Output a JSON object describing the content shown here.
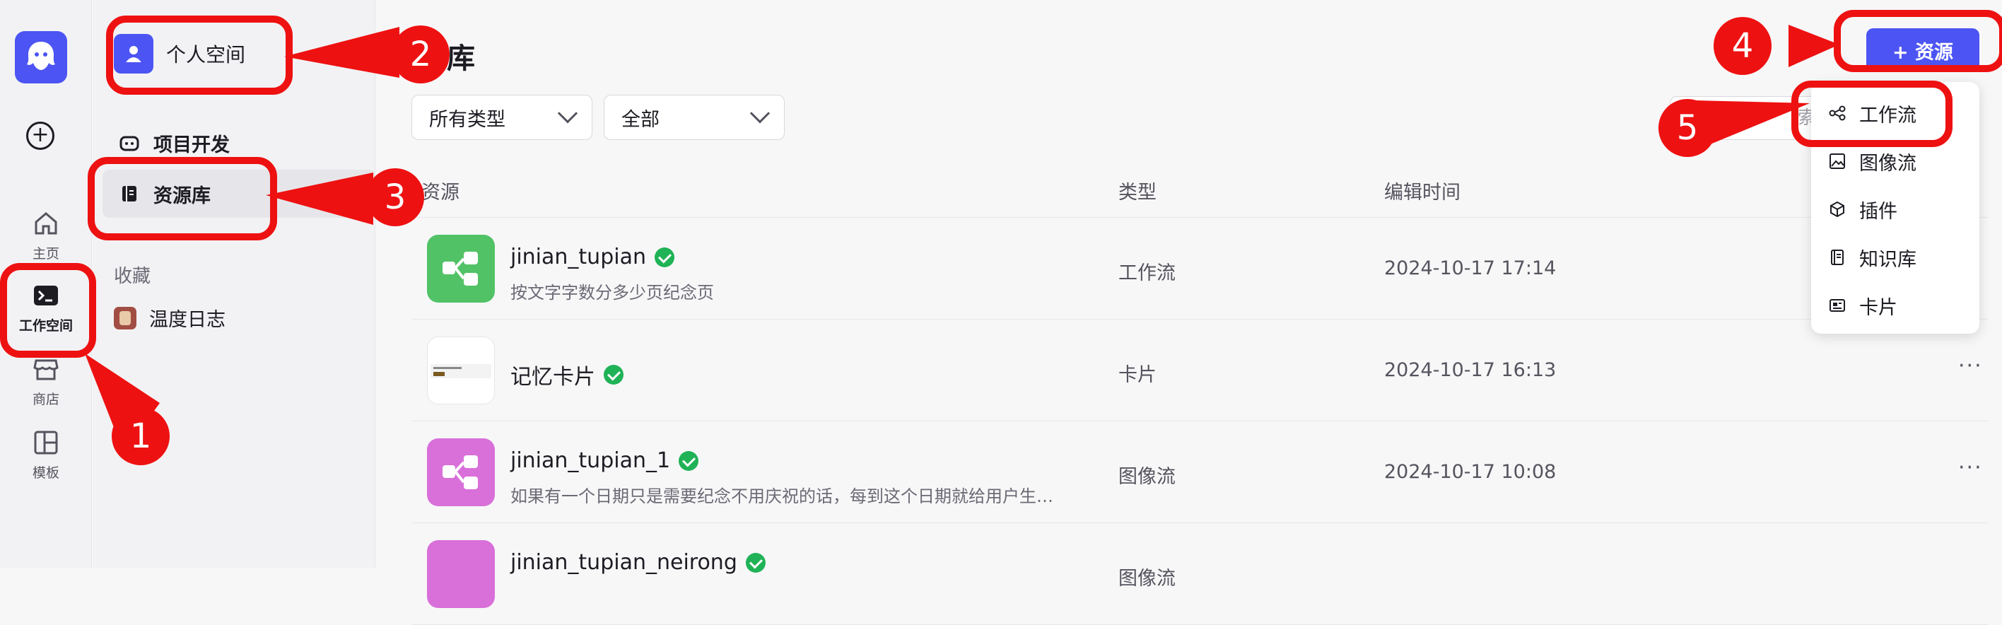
{
  "rail": {
    "items": [
      {
        "label": "主页"
      },
      {
        "label": "工作空间"
      },
      {
        "label": "商店"
      },
      {
        "label": "模板"
      }
    ]
  },
  "nav": {
    "space_label": "个人空间",
    "items": [
      {
        "label": "项目开发"
      },
      {
        "label": "资源库"
      }
    ],
    "favorites_title": "收藏",
    "favorites": [
      {
        "label": "温度日志"
      }
    ]
  },
  "main": {
    "title": "源库",
    "filter_type": "所有类型",
    "filter_scope": "全部",
    "add_button": "+ 资源",
    "search_placeholder": "索资源",
    "columns": [
      "资源",
      "类型",
      "编辑时间"
    ],
    "rows": [
      {
        "name": "jinian_tupian",
        "desc": "按文字字数分多少页纪念页",
        "type": "工作流",
        "time": "2024-10-17 17:14",
        "color": "#52c266",
        "more": ""
      },
      {
        "name": "记忆卡片",
        "desc": "",
        "type": "卡片",
        "time": "2024-10-17 16:13",
        "color": "#ffffff",
        "more": "···"
      },
      {
        "name": "jinian_tupian_1",
        "desc": "如果有一个日期只是需要纪念不用庆祝的话，每到这个日期就给用户生…",
        "type": "图像流",
        "time": "2024-10-17 10:08",
        "color": "#d96fd9",
        "more": "···"
      },
      {
        "name": "jinian_tupian_neirong",
        "desc": "",
        "type": "图像流",
        "time": "",
        "color": "#d96fd9",
        "more": ""
      }
    ]
  },
  "menu": {
    "items": [
      {
        "label": "工作流"
      },
      {
        "label": "图像流"
      },
      {
        "label": "插件"
      },
      {
        "label": "知识库"
      },
      {
        "label": "卡片"
      }
    ]
  },
  "annotations": {
    "labels": [
      "1",
      "2",
      "3",
      "4",
      "5"
    ],
    "color": "#ee1111"
  },
  "colors": {
    "brand": "#4c54f3",
    "verified": "#1fb256"
  }
}
